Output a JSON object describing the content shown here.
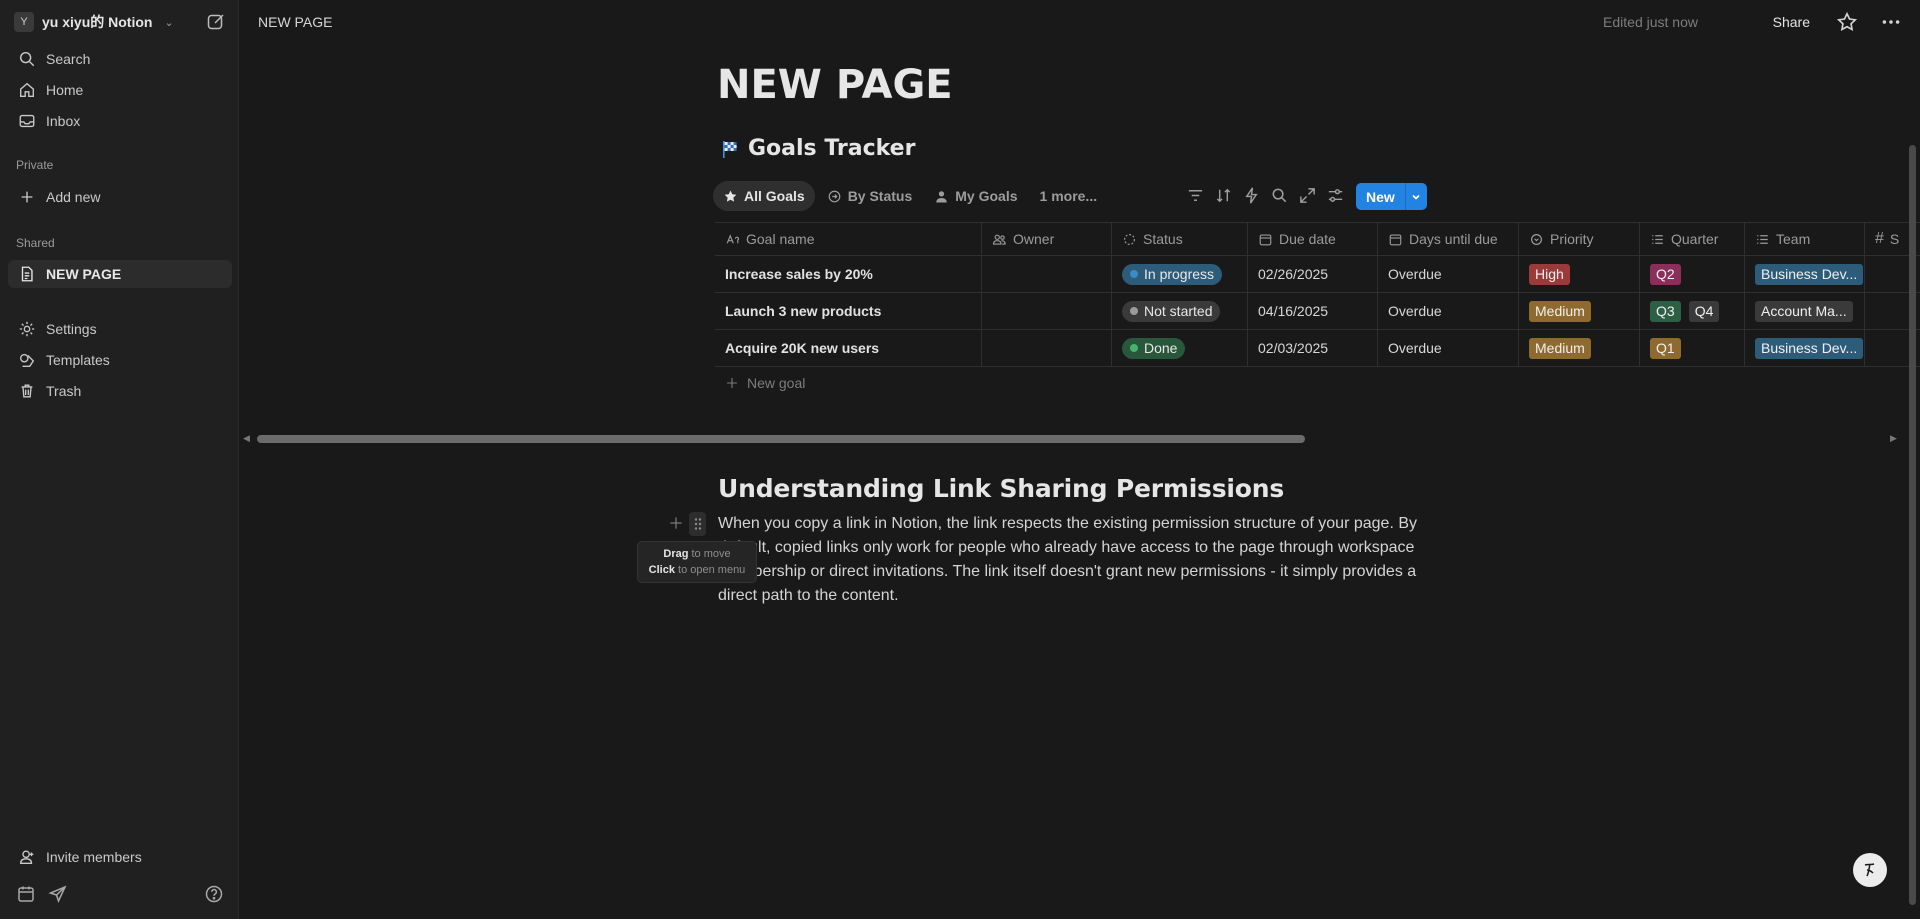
{
  "workspace": {
    "avatar": "Y",
    "name": "yu xiyu的 Notion"
  },
  "sidebar": {
    "top_items": [
      {
        "label": "Search",
        "icon": "search-icon"
      },
      {
        "label": "Home",
        "icon": "home-icon"
      },
      {
        "label": "Inbox",
        "icon": "inbox-icon"
      }
    ],
    "private_label": "Private",
    "add_new": "Add new",
    "shared_label": "Shared",
    "shared_page": "NEW PAGE",
    "bottom_items": [
      {
        "label": "Settings",
        "icon": "gear-icon"
      },
      {
        "label": "Templates",
        "icon": "templates-icon"
      },
      {
        "label": "Trash",
        "icon": "trash-icon"
      }
    ],
    "invite": "Invite members"
  },
  "topbar": {
    "breadcrumb": "NEW PAGE",
    "edited": "Edited just now",
    "share": "Share"
  },
  "page": {
    "title": "NEW PAGE"
  },
  "database": {
    "title": "Goals Tracker",
    "views": [
      "All Goals",
      "By Status",
      "My Goals"
    ],
    "more_views": "1 more...",
    "new_button": "New",
    "columns": [
      "Goal name",
      "Owner",
      "Status",
      "Due date",
      "Days until due",
      "Priority",
      "Quarter",
      "Team",
      "S"
    ],
    "rows": [
      {
        "goal": "Increase sales by 20%",
        "owner": "",
        "status": "In progress",
        "due": "02/26/2025",
        "days": "Overdue",
        "priority": "High",
        "quarters": [
          "Q2"
        ],
        "team": "Business Dev..."
      },
      {
        "goal": "Launch 3 new products",
        "owner": "",
        "status": "Not started",
        "due": "04/16/2025",
        "days": "Overdue",
        "priority": "Medium",
        "quarters": [
          "Q3",
          "Q4"
        ],
        "team": "Account Ma..."
      },
      {
        "goal": "Acquire 20K new users",
        "owner": "",
        "status": "Done",
        "due": "02/03/2025",
        "days": "Overdue",
        "priority": "Medium",
        "quarters": [
          "Q1"
        ],
        "team": "Business Dev..."
      }
    ],
    "new_goal": "New goal"
  },
  "content": {
    "heading": "Understanding Link Sharing Permissions",
    "paragraph": "When you copy a link in Notion, the link respects the existing permission structure of your page. By default, copied links only work for people who already have access to the page through workspace membership or direct invitations. The link itself doesn't grant new permissions - it simply provides a direct path to the content."
  },
  "tooltip": {
    "drag": "Drag",
    "drag_rest": " to move",
    "click": "Click",
    "click_rest": " to open menu"
  },
  "colors": {
    "status_in_progress": "#2c5c7a",
    "status_in_progress_dot": "#3b8bc4",
    "status_not_started": "#3a3a3a",
    "status_not_started_dot": "#9b9b9b",
    "status_done": "#28573c",
    "status_done_dot": "#4caf72",
    "priority_high": "#9b3a3a",
    "priority_medium": "#8f6a2e",
    "q1": "#8f6a2e",
    "q2": "#8a2f5c",
    "q3": "#2c5f44",
    "q4": "#3a3a3a",
    "team_business": "#2c5c7a",
    "team_account": "#3a3a3a",
    "accent": "#2383e2"
  }
}
